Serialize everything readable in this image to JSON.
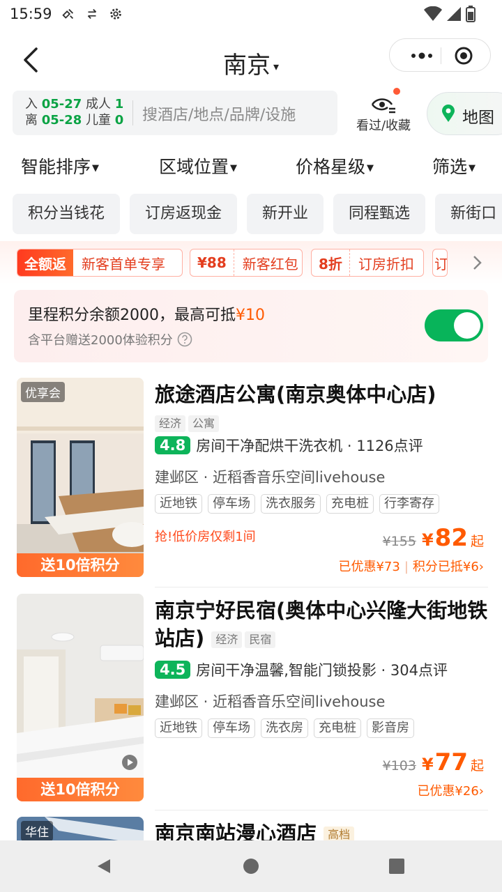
{
  "status_bar": {
    "time": "15:59"
  },
  "header": {
    "city": "南京",
    "caret": "▾"
  },
  "search": {
    "checkin_label": "入",
    "checkin_date": "05-27",
    "checkout_label": "离",
    "checkout_date": "05-28",
    "adult_label": "成人",
    "adult_count": "1",
    "child_label": "儿童",
    "child_count": "0",
    "placeholder": "搜酒店/地点/品牌/设施",
    "history_label": "看过/收藏",
    "map_label": "地图"
  },
  "sort": [
    "智能排序",
    "区域位置",
    "价格星级",
    "筛选"
  ],
  "quick_tags": [
    "积分当钱花",
    "订房返现金",
    "新开业",
    "同程甄选",
    "新街口"
  ],
  "coupons": [
    {
      "left": "全额返",
      "right": "新客首单专享"
    },
    {
      "left": "¥88",
      "right": "新客红包"
    },
    {
      "left": "8折",
      "right": "订房折扣"
    },
    {
      "left": "订",
      "right": ""
    }
  ],
  "points": {
    "main_prefix": "里程积分余额2000，最高可抵",
    "main_amount": "¥10",
    "sub": "含平台赠送2000体验积分",
    "toggle_on": true
  },
  "hotels": [
    {
      "badge": "优享会",
      "img_bottom": "送10倍积分",
      "name": "旅途酒店公寓(南京奥体中心店)",
      "tags": [
        "经济",
        "公寓"
      ],
      "score": "4.8",
      "review": "房间干净配烘干洗衣机 · 1126点评",
      "location": "建邺区 · 近稻香音乐空间livehouse",
      "facilities": [
        "近地铁",
        "停车场",
        "洗衣服务",
        "充电桩",
        "行李寄存"
      ],
      "urgent": "抢!低价房仅剩1间",
      "old_price": "¥155",
      "yen": "¥",
      "price": "82",
      "price_suffix": "起",
      "discount": "已优惠¥73",
      "discount2": "积分已抵¥6",
      "arrow": "›"
    },
    {
      "img_bottom": "送10倍积分",
      "name": "南京宁好民宿(奥体中心兴隆大街地铁站店)",
      "tags": [
        "经济",
        "民宿"
      ],
      "score": "4.5",
      "review": "房间干净温馨,智能门锁投影 · 304点评",
      "location": "建邺区 · 近稻香音乐空间livehouse",
      "facilities": [
        "近地铁",
        "停车场",
        "洗衣房",
        "充电桩",
        "影音房"
      ],
      "old_price": "¥103",
      "yen": "¥",
      "price": "77",
      "price_suffix": "起",
      "discount": "已优惠¥26",
      "arrow": "›"
    },
    {
      "badge": "华住",
      "name": "南京南站漫心酒店",
      "tags": [
        "高档"
      ]
    }
  ],
  "colors": {
    "green": "#0db45a",
    "orange": "#ff5a00",
    "red": "#e33d1e"
  }
}
